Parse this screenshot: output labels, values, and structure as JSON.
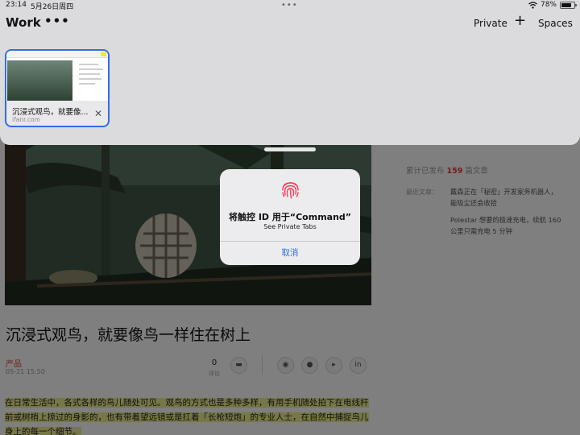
{
  "status_bar": {
    "time": "23:14",
    "date": "5月26日周四",
    "dots": "•••",
    "battery": "78%",
    "battery_level": 0.78
  },
  "tab_group": {
    "title": "Work",
    "menu": "•••",
    "private_label": "Private",
    "add_label": "+",
    "spaces_label": "Spaces"
  },
  "tabs": [
    {
      "title": "沉浸式观鸟，就要像...",
      "url": "ifanr.com",
      "selected": true
    }
  ],
  "article": {
    "title": "沉浸式观鸟，就要像鸟一样住在树上",
    "category": "产品",
    "date": "05-21 15:50",
    "comment_count": "0",
    "comment_label": "评论",
    "body": "在日常生活中，各式各样的鸟儿随处可见。观鸟的方式也是多种多样，有用手机随处拍下在电线杆前或树梢上掠过的身影的，也有带着望远镜或是扛着「长枪短炮」的专业人士，在自然中捕捉鸟儿身上的每一个细节。"
  },
  "sidebar": {
    "stat_prefix": "累计已发布",
    "stat_count": "159",
    "stat_suffix": "篇文章",
    "recent_label": "最近文章：",
    "recent": [
      "戴森正在「秘密」开发家务机器人，能吸尘还会收拾",
      "Polestar 想要的极速充电，续航 160 公里只需充电 5 分钟"
    ]
  },
  "alert": {
    "title": "将触控 ID 用于“Command”",
    "message": "See Private Tabs",
    "cancel": "取消"
  },
  "colors": {
    "accent": "#2f6ee3",
    "highlight": "#f1ee8e",
    "category_red": "#e23b3b",
    "fingerprint": "#ff3b5c"
  },
  "icons": [
    "wifi-icon",
    "battery-icon",
    "fingerprint-icon",
    "close-icon",
    "comment-icon",
    "weibo-icon",
    "wechat-icon",
    "twitter-icon",
    "linkedin-icon"
  ]
}
